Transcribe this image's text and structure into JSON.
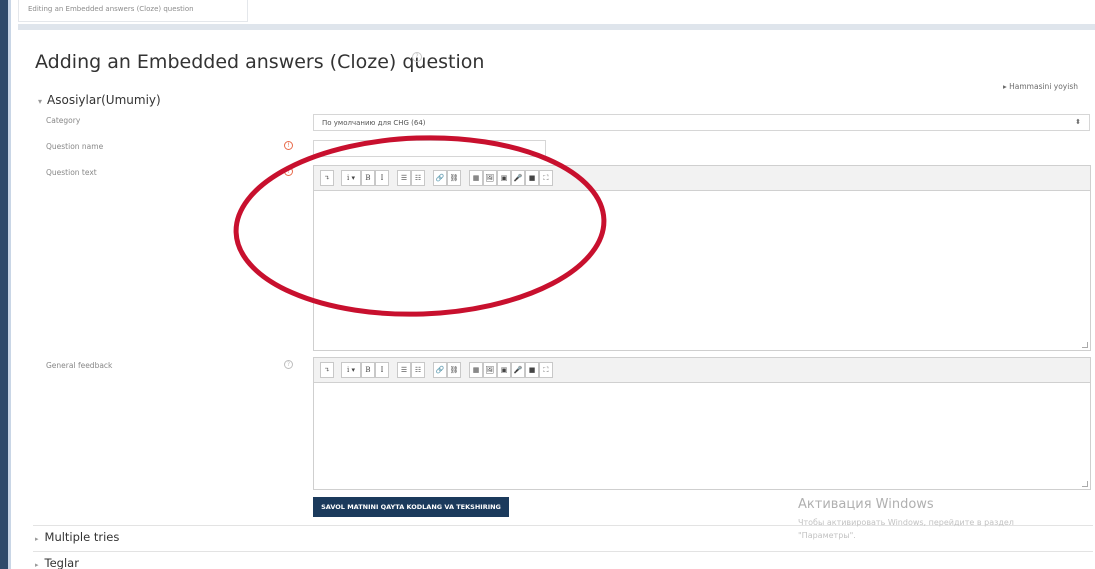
{
  "breadcrumb": {
    "text": "Editing an Embedded answers (Cloze) question"
  },
  "page": {
    "title": "Adding an Embedded answers (Cloze) question"
  },
  "expand_all": {
    "label": "Hammasini yoyish"
  },
  "section_general": {
    "title": "Asosiylar(Umumiy)"
  },
  "fields": {
    "category": {
      "label": "Category",
      "value": "По умолчанию для CHG (64)"
    },
    "question_name": {
      "label": "Question name",
      "value": ""
    },
    "question_text": {
      "label": "Question text"
    },
    "general_feedback": {
      "label": "General feedback"
    }
  },
  "toolbar": {
    "buttons": [
      "↴",
      "i ▾",
      "B",
      "I",
      "☰",
      "☷",
      "🔗",
      "⛓",
      "▦",
      "🖼",
      "▣",
      "🎤",
      "■",
      "⛶"
    ]
  },
  "submit": {
    "label": "SAVOL MATNINI QAYTA KODLANG VA TEKSHIRING"
  },
  "sections_collapsed": [
    {
      "title": "Multiple tries"
    },
    {
      "title": "Teglar"
    }
  ],
  "watermark": {
    "title": "Активация Windows",
    "line1": "Чтобы активировать Windows, перейдите в раздел",
    "line2": "\"Параметры\"."
  },
  "colors": {
    "annotation": "#c8102e",
    "primary_button": "#1b3a5c",
    "required_icon": "#e86a4a"
  }
}
